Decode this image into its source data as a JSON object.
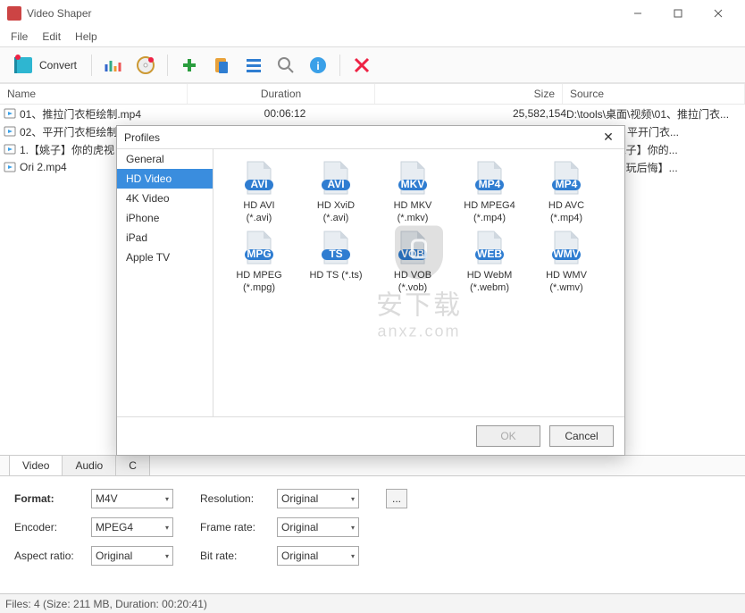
{
  "window": {
    "title": "Video Shaper"
  },
  "menus": [
    "File",
    "Edit",
    "Help"
  ],
  "toolbar": {
    "convert": "Convert"
  },
  "columns": {
    "name": "Name",
    "duration": "Duration",
    "size": "Size",
    "source": "Source"
  },
  "files": [
    {
      "name": "01、推拉门衣柜绘制.mp4",
      "duration": "00:06:12",
      "size": "25,582,154",
      "source": "D:\\tools\\桌面\\视频\\01、推拉门衣..."
    },
    {
      "name": "02、平开门衣柜绘制",
      "duration": "",
      "size": "",
      "source": "面\\视频\\02、平开门衣..."
    },
    {
      "name": "1.【姚子】你的虎视",
      "duration": "",
      "size": "",
      "source": "面\\视频\\【姚子】你的..."
    },
    {
      "name": "Ori 2.mp4",
      "duration": "",
      "size": "",
      "source": "面\\视频\\【不玩后悔】..."
    }
  ],
  "tabs": [
    "Video",
    "Audio",
    "C"
  ],
  "fields": {
    "format": {
      "label": "Format:",
      "value": "M4V"
    },
    "encoder": {
      "label": "Encoder:",
      "value": "MPEG4"
    },
    "aspect": {
      "label": "Aspect ratio:",
      "value": "Original"
    },
    "resolution": {
      "label": "Resolution:",
      "value": "Original"
    },
    "framerate": {
      "label": "Frame rate:",
      "value": "Original"
    },
    "bitrate": {
      "label": "Bit rate:",
      "value": "Original"
    },
    "browse": "..."
  },
  "status": "Files: 4 (Size: 211 MB, Duration: 00:20:41)",
  "dialog": {
    "title": "Profiles",
    "ok": "OK",
    "cancel": "Cancel",
    "categories": [
      "General",
      "HD Video",
      "4K Video",
      "iPhone",
      "iPad",
      "Apple TV"
    ],
    "selected_category": 1,
    "items": [
      {
        "badge": "AVI",
        "label1": "HD AVI",
        "label2": "(*.avi)"
      },
      {
        "badge": "AVI",
        "label1": "HD XviD",
        "label2": "(*.avi)"
      },
      {
        "badge": "MKV",
        "label1": "HD MKV",
        "label2": "(*.mkv)"
      },
      {
        "badge": "MP4",
        "label1": "HD MPEG4",
        "label2": "(*.mp4)"
      },
      {
        "badge": "MP4",
        "label1": "HD AVC",
        "label2": "(*.mp4)"
      },
      {
        "badge": "MPG",
        "label1": "HD MPEG",
        "label2": "(*.mpg)"
      },
      {
        "badge": "TS",
        "label1": "HD TS (*.ts)",
        "label2": ""
      },
      {
        "badge": "VOB",
        "label1": "HD VOB",
        "label2": "(*.vob)"
      },
      {
        "badge": "WEB",
        "label1": "HD WebM",
        "label2": "(*.webm)"
      },
      {
        "badge": "WMV",
        "label1": "HD WMV",
        "label2": "(*.wmv)"
      }
    ]
  },
  "watermark": {
    "line1": "安下载",
    "line2": "anxz.com"
  }
}
